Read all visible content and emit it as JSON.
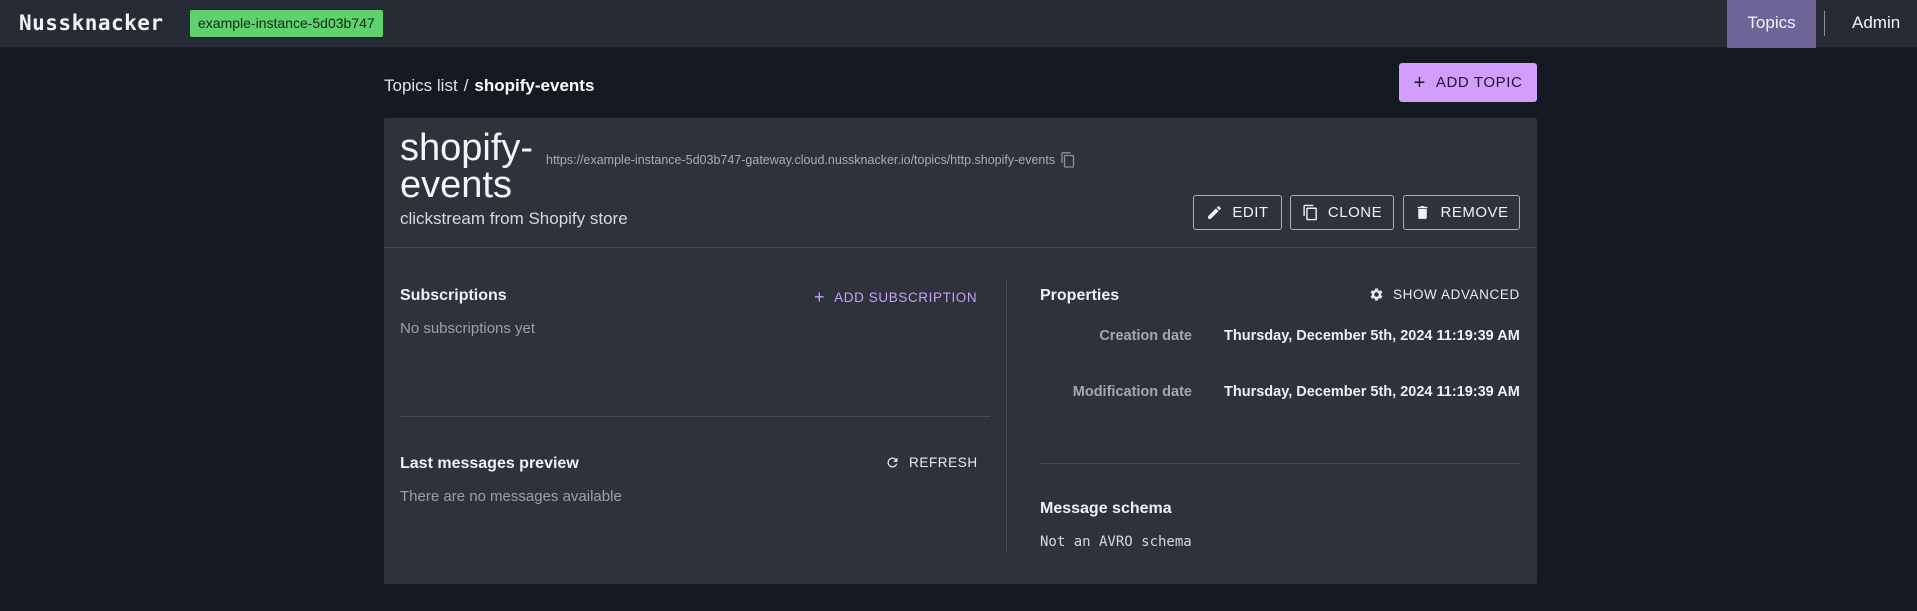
{
  "app": {
    "logo": "Nussknacker",
    "instance_badge": "example-instance-5d03b747"
  },
  "nav": {
    "topics": "Topics",
    "admin": "Admin"
  },
  "breadcrumb": {
    "parent": "Topics list",
    "separator": "/",
    "current": "shopify-events"
  },
  "toolbar": {
    "add_topic_label": "ADD TOPIC"
  },
  "topic": {
    "name": "shopify-events",
    "url": "https://example-instance-5d03b747-gateway.cloud.nussknacker.io/topics/http.shopify-events",
    "description": "clickstream from Shopify store",
    "actions": {
      "edit": "EDIT",
      "clone": "CLONE",
      "remove": "REMOVE"
    }
  },
  "subscriptions": {
    "title": "Subscriptions",
    "add_label": "ADD SUBSCRIPTION",
    "empty_text": "No subscriptions yet"
  },
  "messages": {
    "title": "Last messages preview",
    "refresh_label": "REFRESH",
    "empty_text": "There are no messages available"
  },
  "properties": {
    "title": "Properties",
    "show_advanced_label": "SHOW ADVANCED",
    "items": [
      {
        "label": "Creation date",
        "value": "Thursday, December 5th, 2024 11:19:39 AM"
      },
      {
        "label": "Modification date",
        "value": "Thursday, December 5th, 2024 11:19:39 AM"
      }
    ]
  },
  "schema": {
    "title": "Message schema",
    "value": "Not an AVRO schema"
  },
  "colors": {
    "accent": "#d39dfb",
    "active_nav": "#6e6498",
    "badge": "#5fd16e",
    "card": "#2d323d",
    "background": "#151922"
  },
  "icons": [
    "copy-icon",
    "pencil-icon",
    "clone-icon",
    "trash-icon",
    "plus-icon",
    "gear-icon",
    "refresh-icon"
  ]
}
